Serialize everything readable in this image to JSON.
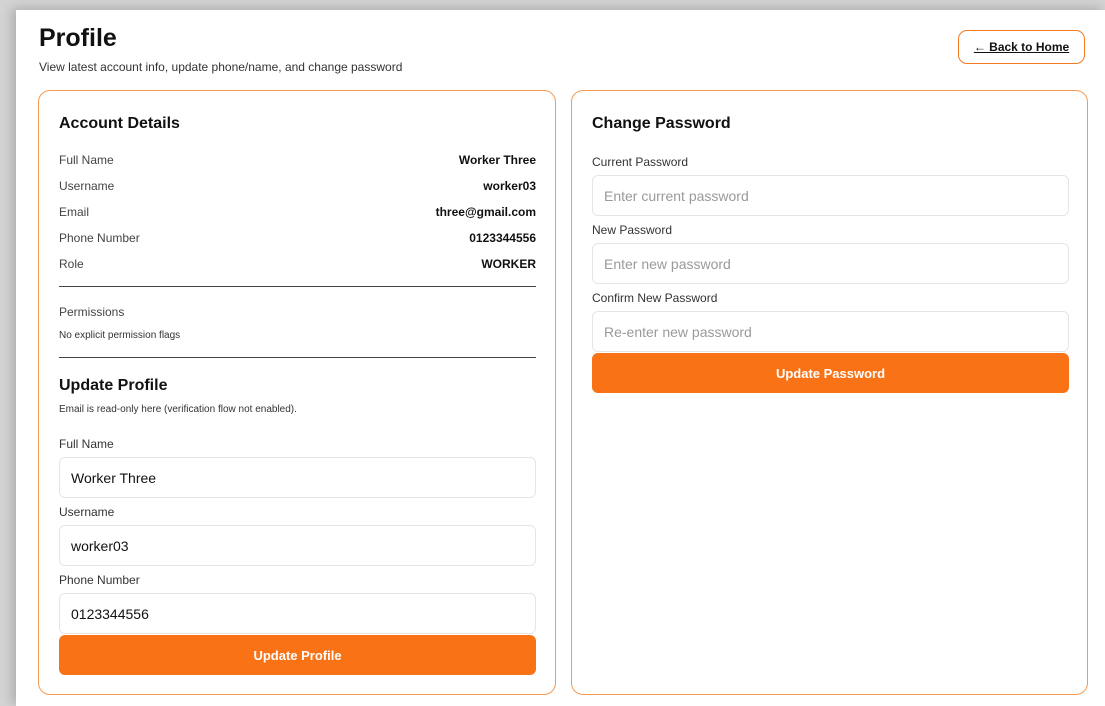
{
  "header": {
    "title": "Profile",
    "subtitle": "View latest account info, update phone/name, and change password",
    "back_label": "← Back to Home"
  },
  "account_details": {
    "title": "Account Details",
    "rows": [
      {
        "label": "Full Name",
        "value": "Worker Three"
      },
      {
        "label": "Username",
        "value": "worker03"
      },
      {
        "label": "Email",
        "value": "three@gmail.com"
      },
      {
        "label": "Phone Number",
        "value": "0123344556"
      },
      {
        "label": "Role",
        "value": "WORKER"
      }
    ],
    "permissions_label": "Permissions",
    "permissions_value": "No explicit permission flags"
  },
  "update_profile": {
    "title": "Update Profile",
    "note": "Email is read-only here (verification flow not enabled).",
    "fields": [
      {
        "label": "Full Name",
        "value": "Worker Three"
      },
      {
        "label": "Username",
        "value": "worker03"
      },
      {
        "label": "Phone Number",
        "value": "0123344556"
      }
    ],
    "button_label": "Update Profile"
  },
  "change_password": {
    "title": "Change Password",
    "fields": [
      {
        "label": "Current Password",
        "placeholder": "Enter current password"
      },
      {
        "label": "New Password",
        "placeholder": "Enter new password"
      },
      {
        "label": "Confirm New Password",
        "placeholder": "Re-enter new password"
      }
    ],
    "button_label": "Update Password"
  },
  "colors": {
    "accent": "#f97316",
    "card_border": "#f39a52"
  }
}
